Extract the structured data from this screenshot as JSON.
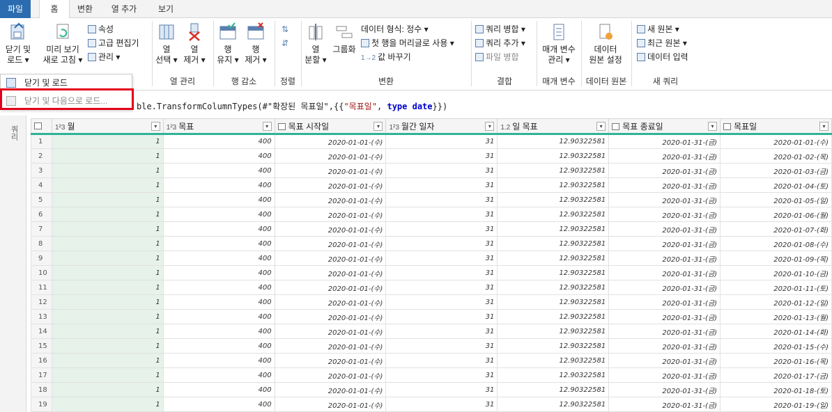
{
  "tabs": {
    "file": "파일",
    "home": "홈",
    "transform": "변환",
    "add_column": "열 추가",
    "view": "보기"
  },
  "ribbon": {
    "close_load": [
      "닫기 및",
      "로드 ▾"
    ],
    "preview_refresh": [
      "미리 보기",
      "새로 고침 ▾"
    ],
    "properties": "속성",
    "advanced_editor": "고급 편집기",
    "manage": "관리 ▾",
    "choose_columns": [
      "열",
      "선택 ▾"
    ],
    "remove_columns": [
      "열",
      "제거 ▾"
    ],
    "keep_rows": [
      "행",
      "유지 ▾"
    ],
    "remove_rows": [
      "행",
      "제거 ▾"
    ],
    "split_column": [
      "열",
      "분할 ▾"
    ],
    "group_by": "그룹화",
    "data_type": "데이터 형식: 정수 ▾",
    "first_row_header": "첫 행을 머리글로 사용 ▾",
    "replace_values": "값 바꾸기",
    "merge_queries": "쿼리 병합 ▾",
    "append_queries": "쿼리 추가 ▾",
    "combine_files": "파일 병합",
    "manage_params": [
      "매개 변수",
      "관리 ▾"
    ],
    "data_source_settings": [
      "데이터",
      "원본 설정"
    ],
    "new_source": "새 원본 ▾",
    "recent_sources": "최근 원본 ▾",
    "enter_data": "데이터 입력",
    "groups": {
      "columns": "열 관리",
      "reduce_rows": "행 감소",
      "sort": "정렬",
      "transform": "변환",
      "combine": "결합",
      "params": "매개 변수",
      "data_sources": "데이터 원본",
      "new_query": "새 쿼리"
    }
  },
  "menu": {
    "close_load": "닫기 및 로드",
    "close_load_to": "닫기 및 다음으로 로드..."
  },
  "formula": {
    "prefix": "ble.TransformColumnTypes(#\"확장된 목표일\",{{",
    "string": "\"목표일\"",
    "comma": ", ",
    "keyword": "type date",
    "suffix": "}})"
  },
  "query_pane_label": "쿼리",
  "columns": [
    {
      "type": "1²3",
      "name": "월"
    },
    {
      "type": "1²3",
      "name": "목표"
    },
    {
      "type": "cal",
      "name": "목표 시작일"
    },
    {
      "type": "1²3",
      "name": "월간 일자"
    },
    {
      "type": "1.2",
      "name": "일 목표"
    },
    {
      "type": "cal",
      "name": "목표 종료일"
    },
    {
      "type": "cal",
      "name": "목표일"
    }
  ],
  "rows": [
    [
      "1",
      "1",
      "400",
      "2020-01-01-(수)",
      "31",
      "12.90322581",
      "2020-01-31-(금)",
      "2020-01-01-(수)"
    ],
    [
      "2",
      "1",
      "400",
      "2020-01-01-(수)",
      "31",
      "12.90322581",
      "2020-01-31-(금)",
      "2020-01-02-(목)"
    ],
    [
      "3",
      "1",
      "400",
      "2020-01-01-(수)",
      "31",
      "12.90322581",
      "2020-01-31-(금)",
      "2020-01-03-(금)"
    ],
    [
      "4",
      "1",
      "400",
      "2020-01-01-(수)",
      "31",
      "12.90322581",
      "2020-01-31-(금)",
      "2020-01-04-(토)"
    ],
    [
      "5",
      "1",
      "400",
      "2020-01-01-(수)",
      "31",
      "12.90322581",
      "2020-01-31-(금)",
      "2020-01-05-(일)"
    ],
    [
      "6",
      "1",
      "400",
      "2020-01-01-(수)",
      "31",
      "12.90322581",
      "2020-01-31-(금)",
      "2020-01-06-(월)"
    ],
    [
      "7",
      "1",
      "400",
      "2020-01-01-(수)",
      "31",
      "12.90322581",
      "2020-01-31-(금)",
      "2020-01-07-(화)"
    ],
    [
      "8",
      "1",
      "400",
      "2020-01-01-(수)",
      "31",
      "12.90322581",
      "2020-01-31-(금)",
      "2020-01-08-(수)"
    ],
    [
      "9",
      "1",
      "400",
      "2020-01-01-(수)",
      "31",
      "12.90322581",
      "2020-01-31-(금)",
      "2020-01-09-(목)"
    ],
    [
      "10",
      "1",
      "400",
      "2020-01-01-(수)",
      "31",
      "12.90322581",
      "2020-01-31-(금)",
      "2020-01-10-(금)"
    ],
    [
      "11",
      "1",
      "400",
      "2020-01-01-(수)",
      "31",
      "12.90322581",
      "2020-01-31-(금)",
      "2020-01-11-(토)"
    ],
    [
      "12",
      "1",
      "400",
      "2020-01-01-(수)",
      "31",
      "12.90322581",
      "2020-01-31-(금)",
      "2020-01-12-(일)"
    ],
    [
      "13",
      "1",
      "400",
      "2020-01-01-(수)",
      "31",
      "12.90322581",
      "2020-01-31-(금)",
      "2020-01-13-(월)"
    ],
    [
      "14",
      "1",
      "400",
      "2020-01-01-(수)",
      "31",
      "12.90322581",
      "2020-01-31-(금)",
      "2020-01-14-(화)"
    ],
    [
      "15",
      "1",
      "400",
      "2020-01-01-(수)",
      "31",
      "12.90322581",
      "2020-01-31-(금)",
      "2020-01-15-(수)"
    ],
    [
      "16",
      "1",
      "400",
      "2020-01-01-(수)",
      "31",
      "12.90322581",
      "2020-01-31-(금)",
      "2020-01-16-(목)"
    ],
    [
      "17",
      "1",
      "400",
      "2020-01-01-(수)",
      "31",
      "12.90322581",
      "2020-01-31-(금)",
      "2020-01-17-(금)"
    ],
    [
      "18",
      "1",
      "400",
      "2020-01-01-(수)",
      "31",
      "12.90322581",
      "2020-01-31-(금)",
      "2020-01-18-(토)"
    ],
    [
      "19",
      "1",
      "400",
      "2020-01-01-(수)",
      "31",
      "12.90322581",
      "2020-01-31-(금)",
      "2020-01-19-(일)"
    ]
  ]
}
